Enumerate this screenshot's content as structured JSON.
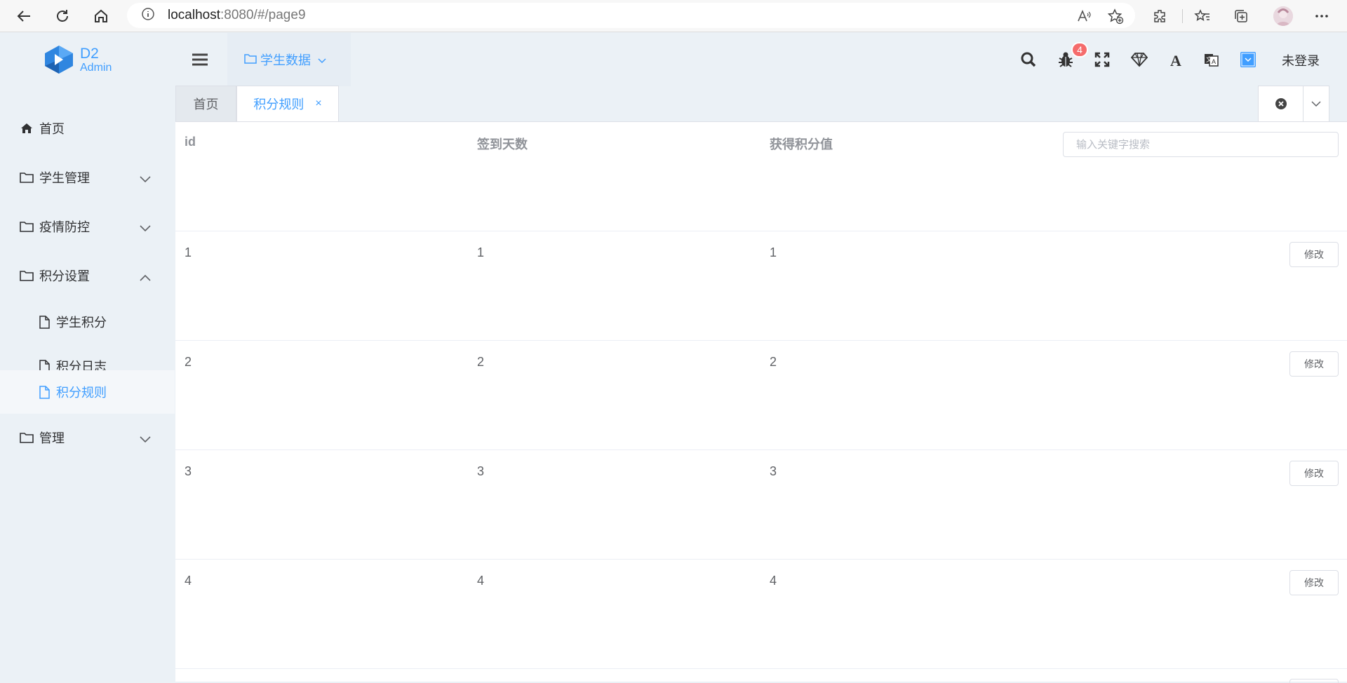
{
  "browser": {
    "url_host": "localhost",
    "url_rest": ":8080/#/page9",
    "icons": [
      "back-icon",
      "refresh-icon",
      "home-icon",
      "info-icon",
      "read-aloud-icon",
      "add-favorite-icon",
      "extensions-icon",
      "favorites-icon",
      "collections-icon",
      "more-icon"
    ]
  },
  "logo": {
    "line1": "D2",
    "line2": "Admin"
  },
  "sidebar": {
    "items": [
      {
        "label": "首页",
        "icon": "home-icon"
      },
      {
        "label": "学生管理",
        "icon": "folder-icon"
      },
      {
        "label": "疫情防控",
        "icon": "folder-icon"
      },
      {
        "label": "积分设置",
        "icon": "folder-icon"
      },
      {
        "label": "管理",
        "icon": "folder-icon"
      }
    ],
    "sub_items": [
      {
        "label": "学生积分",
        "icon": "file-icon"
      },
      {
        "label": "积分日志",
        "icon": "file-icon"
      },
      {
        "label": "积分规则",
        "icon": "file-icon",
        "active": true
      }
    ]
  },
  "header": {
    "menu_label": "学生数据",
    "badge_count": "4",
    "user": "未登录",
    "icons": [
      "search-icon",
      "bug-icon",
      "fullscreen-icon",
      "theme-icon",
      "font-size-icon",
      "translate-icon",
      "color-picker-icon"
    ]
  },
  "tabs": {
    "home": "首页",
    "current": "积分规则",
    "close": "×"
  },
  "table": {
    "columns": [
      "id",
      "签到天数",
      "获得积分值"
    ],
    "search_placeholder": "输入关键字搜索",
    "edit_label": "修改",
    "rows": [
      [
        "1",
        "1",
        "1"
      ],
      [
        "2",
        "2",
        "2"
      ],
      [
        "3",
        "3",
        "3"
      ],
      [
        "4",
        "4",
        "4"
      ]
    ]
  },
  "colors": {
    "accent": "#409eff",
    "badge": "#f56c6c",
    "sidebar_bg": "#ebf1f6"
  }
}
